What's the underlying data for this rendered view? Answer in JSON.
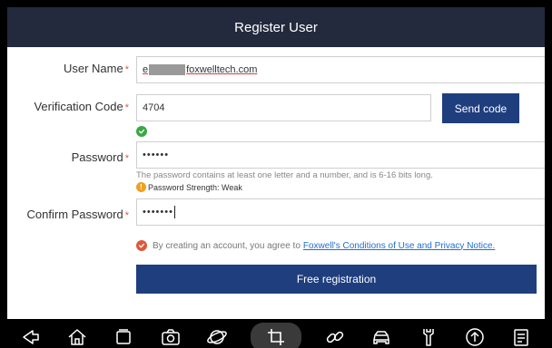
{
  "header": {
    "title": "Register User"
  },
  "form": {
    "user_name": {
      "label": "User Name",
      "value_prefix": "e",
      "value_domain": "foxwelltech.com"
    },
    "verification_code": {
      "label": "Verification Code",
      "value": "4704",
      "send_label": "Send code"
    },
    "password": {
      "label": "Password",
      "value": "••••••",
      "hint": "The password contains at least one letter and a number, and is 6-16 bits long.",
      "strength": "Password Strength: Weak"
    },
    "confirm_password": {
      "label": "Confirm Password",
      "value": "•••••••"
    },
    "required_mark": "*",
    "agreement": {
      "text": "By creating an account, you agree to",
      "link": "Foxwell's Conditions of Use and Privacy Notice."
    },
    "register_label": "Free registration"
  },
  "navbar": {
    "items": [
      "back-icon",
      "home-icon",
      "recent-apps-icon",
      "camera-icon",
      "browser-icon",
      "crop-icon",
      "link-icon",
      "car-icon",
      "wrench-icon",
      "upload-icon",
      "document-icon"
    ],
    "active": "crop-icon"
  },
  "colors": {
    "header_bg": "#232a3d",
    "button_bg": "#1f3e7e",
    "required": "#e05a3a",
    "success": "#39a845",
    "warning": "#f0a020",
    "link": "#1f6fd1"
  }
}
